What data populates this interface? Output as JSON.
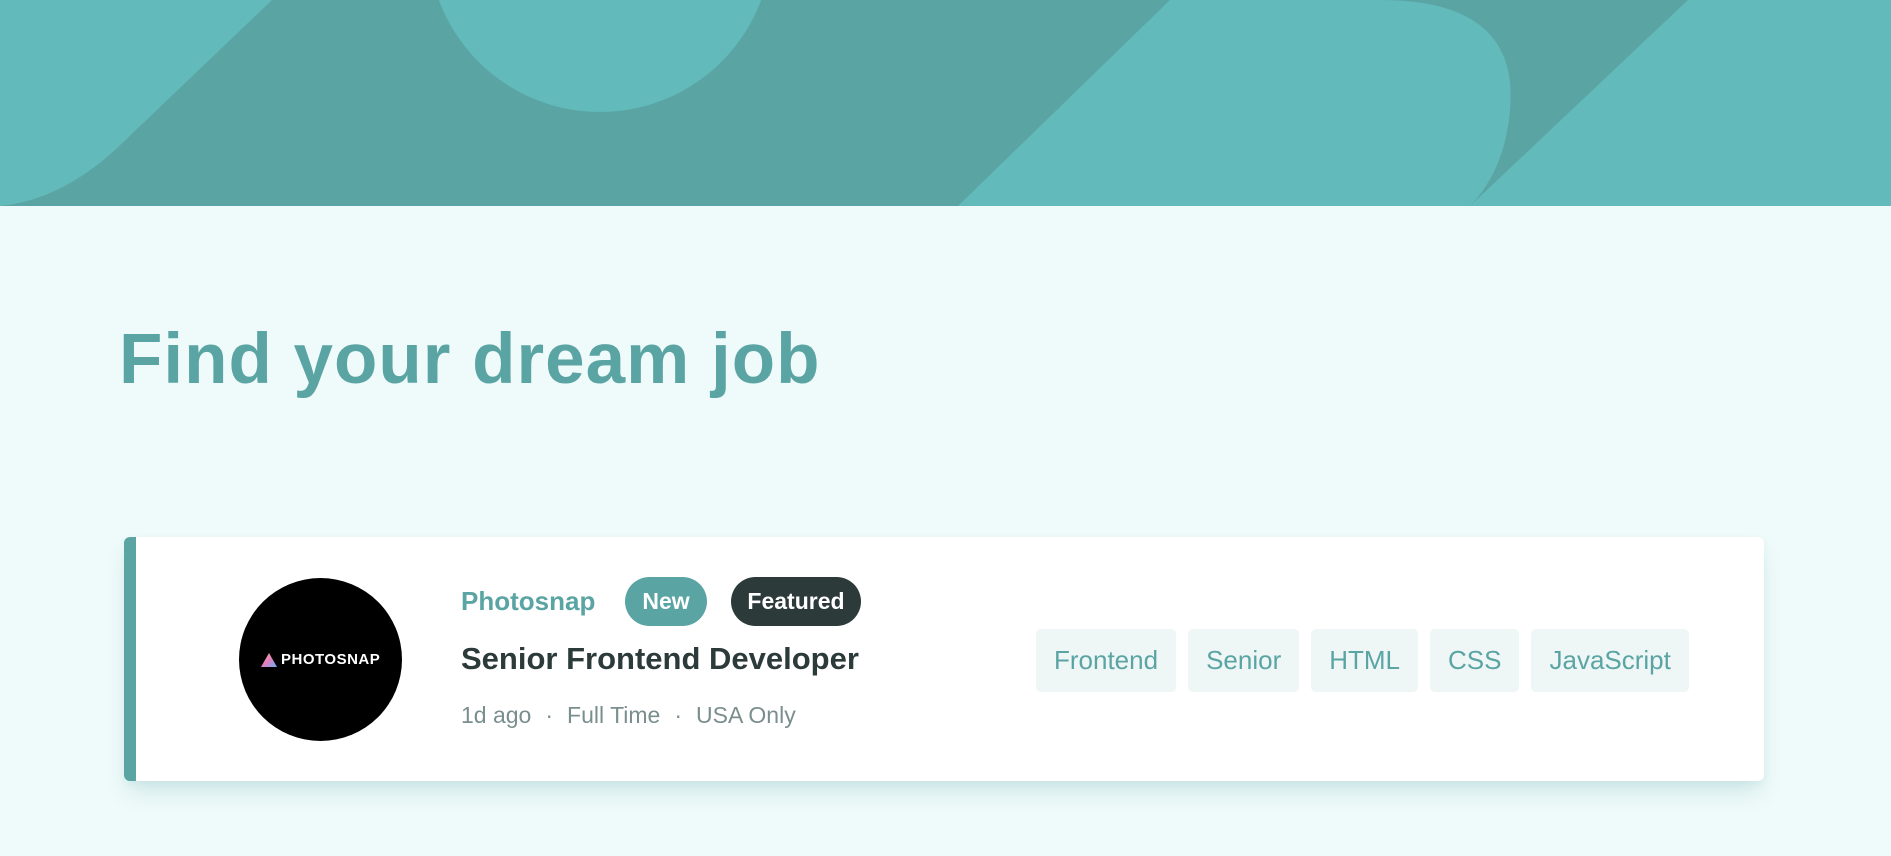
{
  "header": {
    "title": "Find your dream job"
  },
  "colors": {
    "primary": "#5ba4a4",
    "background": "#effafa",
    "tag_background": "#eef6f6",
    "dark": "#2c3a3a",
    "gray": "#7b8e8e"
  },
  "jobs": [
    {
      "company": "Photosnap",
      "logo_text": "PHOTOSNAP",
      "logo_icon": "triangle-logo-icon",
      "badges": {
        "new": "New",
        "featured": "Featured"
      },
      "position": "Senior Frontend Developer",
      "posted_at": "1d ago",
      "contract": "Full Time",
      "location": "USA Only",
      "separator": "·",
      "tags": [
        "Frontend",
        "Senior",
        "HTML",
        "CSS",
        "JavaScript"
      ]
    }
  ]
}
